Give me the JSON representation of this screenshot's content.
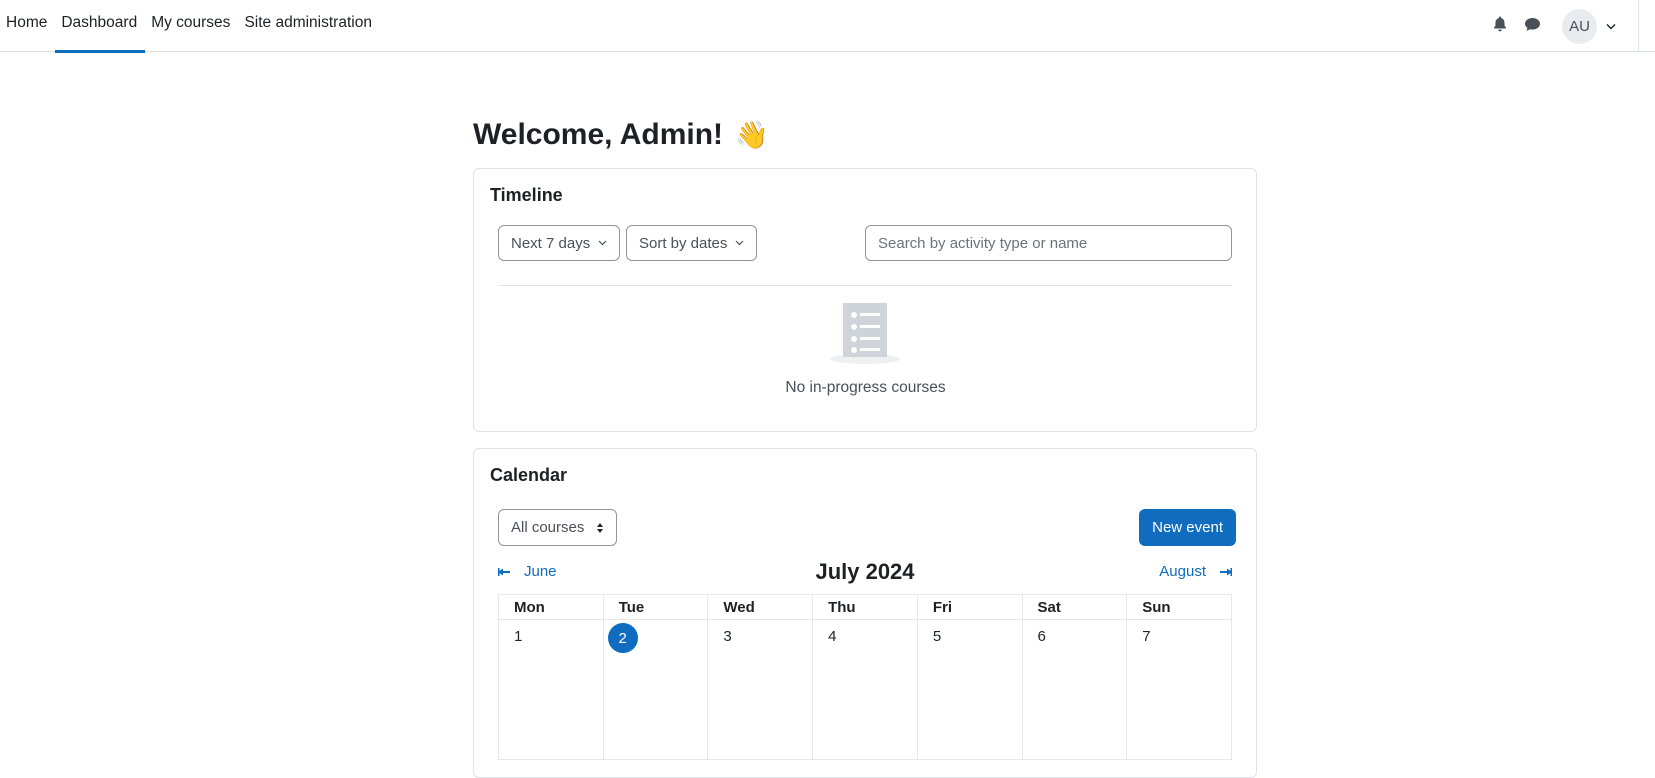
{
  "nav": {
    "links": [
      "Home",
      "Dashboard",
      "My courses",
      "Site administration"
    ],
    "active": "Dashboard",
    "user_initials": "AU"
  },
  "welcome": {
    "title": "Welcome, Admin!",
    "emoji": "👋"
  },
  "timeline": {
    "title": "Timeline",
    "filter_label": "Next 7 days",
    "sort_label": "Sort by dates",
    "search_placeholder": "Search by activity type or name",
    "empty_text": "No in-progress courses"
  },
  "calendar": {
    "title": "Calendar",
    "course_filter": "All courses",
    "new_event_label": "New event",
    "prev_month": "June",
    "next_month": "August",
    "current_month": "July 2024",
    "weekdays": [
      "Mon",
      "Tue",
      "Wed",
      "Thu",
      "Fri",
      "Sat",
      "Sun"
    ],
    "days": [
      "1",
      "2",
      "3",
      "4",
      "5",
      "6",
      "7"
    ],
    "today": "2"
  },
  "colors": {
    "accent": "#0f6cbf",
    "border": "#dee2e6",
    "text": "#1d2125"
  },
  "icons": [
    "bell-icon",
    "chat-icon",
    "chevron-down-icon",
    "sort-icon",
    "list-empty-icon",
    "arrow-left-icon",
    "arrow-right-icon"
  ]
}
